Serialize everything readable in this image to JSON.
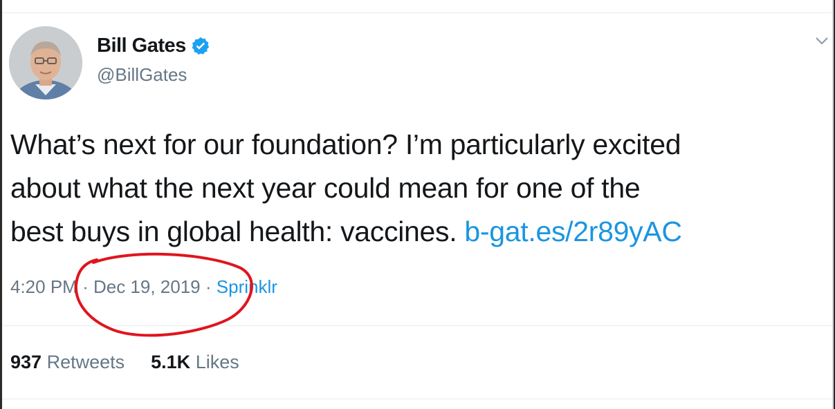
{
  "tweet": {
    "author_name": "Bill Gates",
    "author_handle": "@BillGates",
    "verified_icon": "verified-badge-icon",
    "text_line1": "What’s next for our foundation? I’m particularly excited",
    "text_line2": "about what the next year could mean for one of the",
    "text_line3_prefix": "best buys in global health: vaccines. ",
    "link_text": "b-gat.es/2r89yAC",
    "time": "4:20 PM",
    "date": "Dec 19, 2019",
    "separator": "·",
    "source": "Sprinklr",
    "retweets_count": "937",
    "retweets_label": "Retweets",
    "likes_count": "5.1K",
    "likes_label": "Likes"
  },
  "colors": {
    "link": "#1b95e0",
    "muted": "#657786",
    "text": "#14171a",
    "annotation": "#e0141e"
  },
  "icons": {
    "menu": "chevron-down-icon",
    "avatar": "avatar"
  }
}
